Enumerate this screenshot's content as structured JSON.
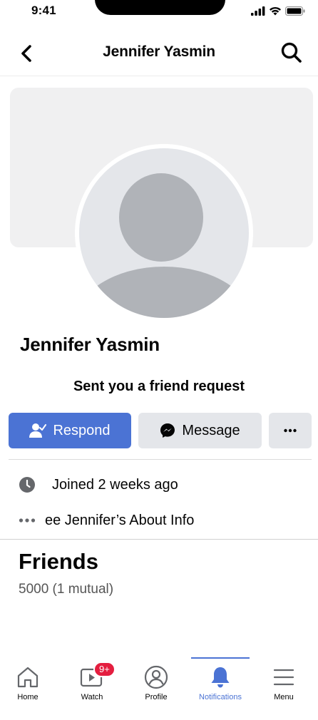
{
  "status_bar": {
    "time": "9:41"
  },
  "header": {
    "title": "Jennifer Yasmin"
  },
  "profile": {
    "name": "Jennifer Yasmin",
    "request_text": "Sent you a friend request"
  },
  "actions": {
    "respond_label": "Respond",
    "message_label": "Message",
    "more_label": "···"
  },
  "info": {
    "joined": "Joined 2 weeks ago",
    "about_prefix": "•••",
    "about": "ee Jennifer’s About Info"
  },
  "friends": {
    "title": "Friends",
    "count": "5000 (1 mutual)"
  },
  "nav": {
    "tabs": [
      {
        "label": "Home",
        "icon": "home-icon",
        "active": false
      },
      {
        "label": "Watch",
        "icon": "watch-icon",
        "badge": "9+",
        "active": false
      },
      {
        "label": "Profile",
        "icon": "profile-icon",
        "active": false
      },
      {
        "label": "Notifications",
        "icon": "bell-icon",
        "active": true
      },
      {
        "label": "Menu",
        "icon": "menu-icon",
        "active": false
      }
    ]
  },
  "colors": {
    "accent": "#4b73d4",
    "button_gray": "#e4e6ea",
    "badge": "#e41e3f",
    "placeholder": "#b0b3b8"
  }
}
